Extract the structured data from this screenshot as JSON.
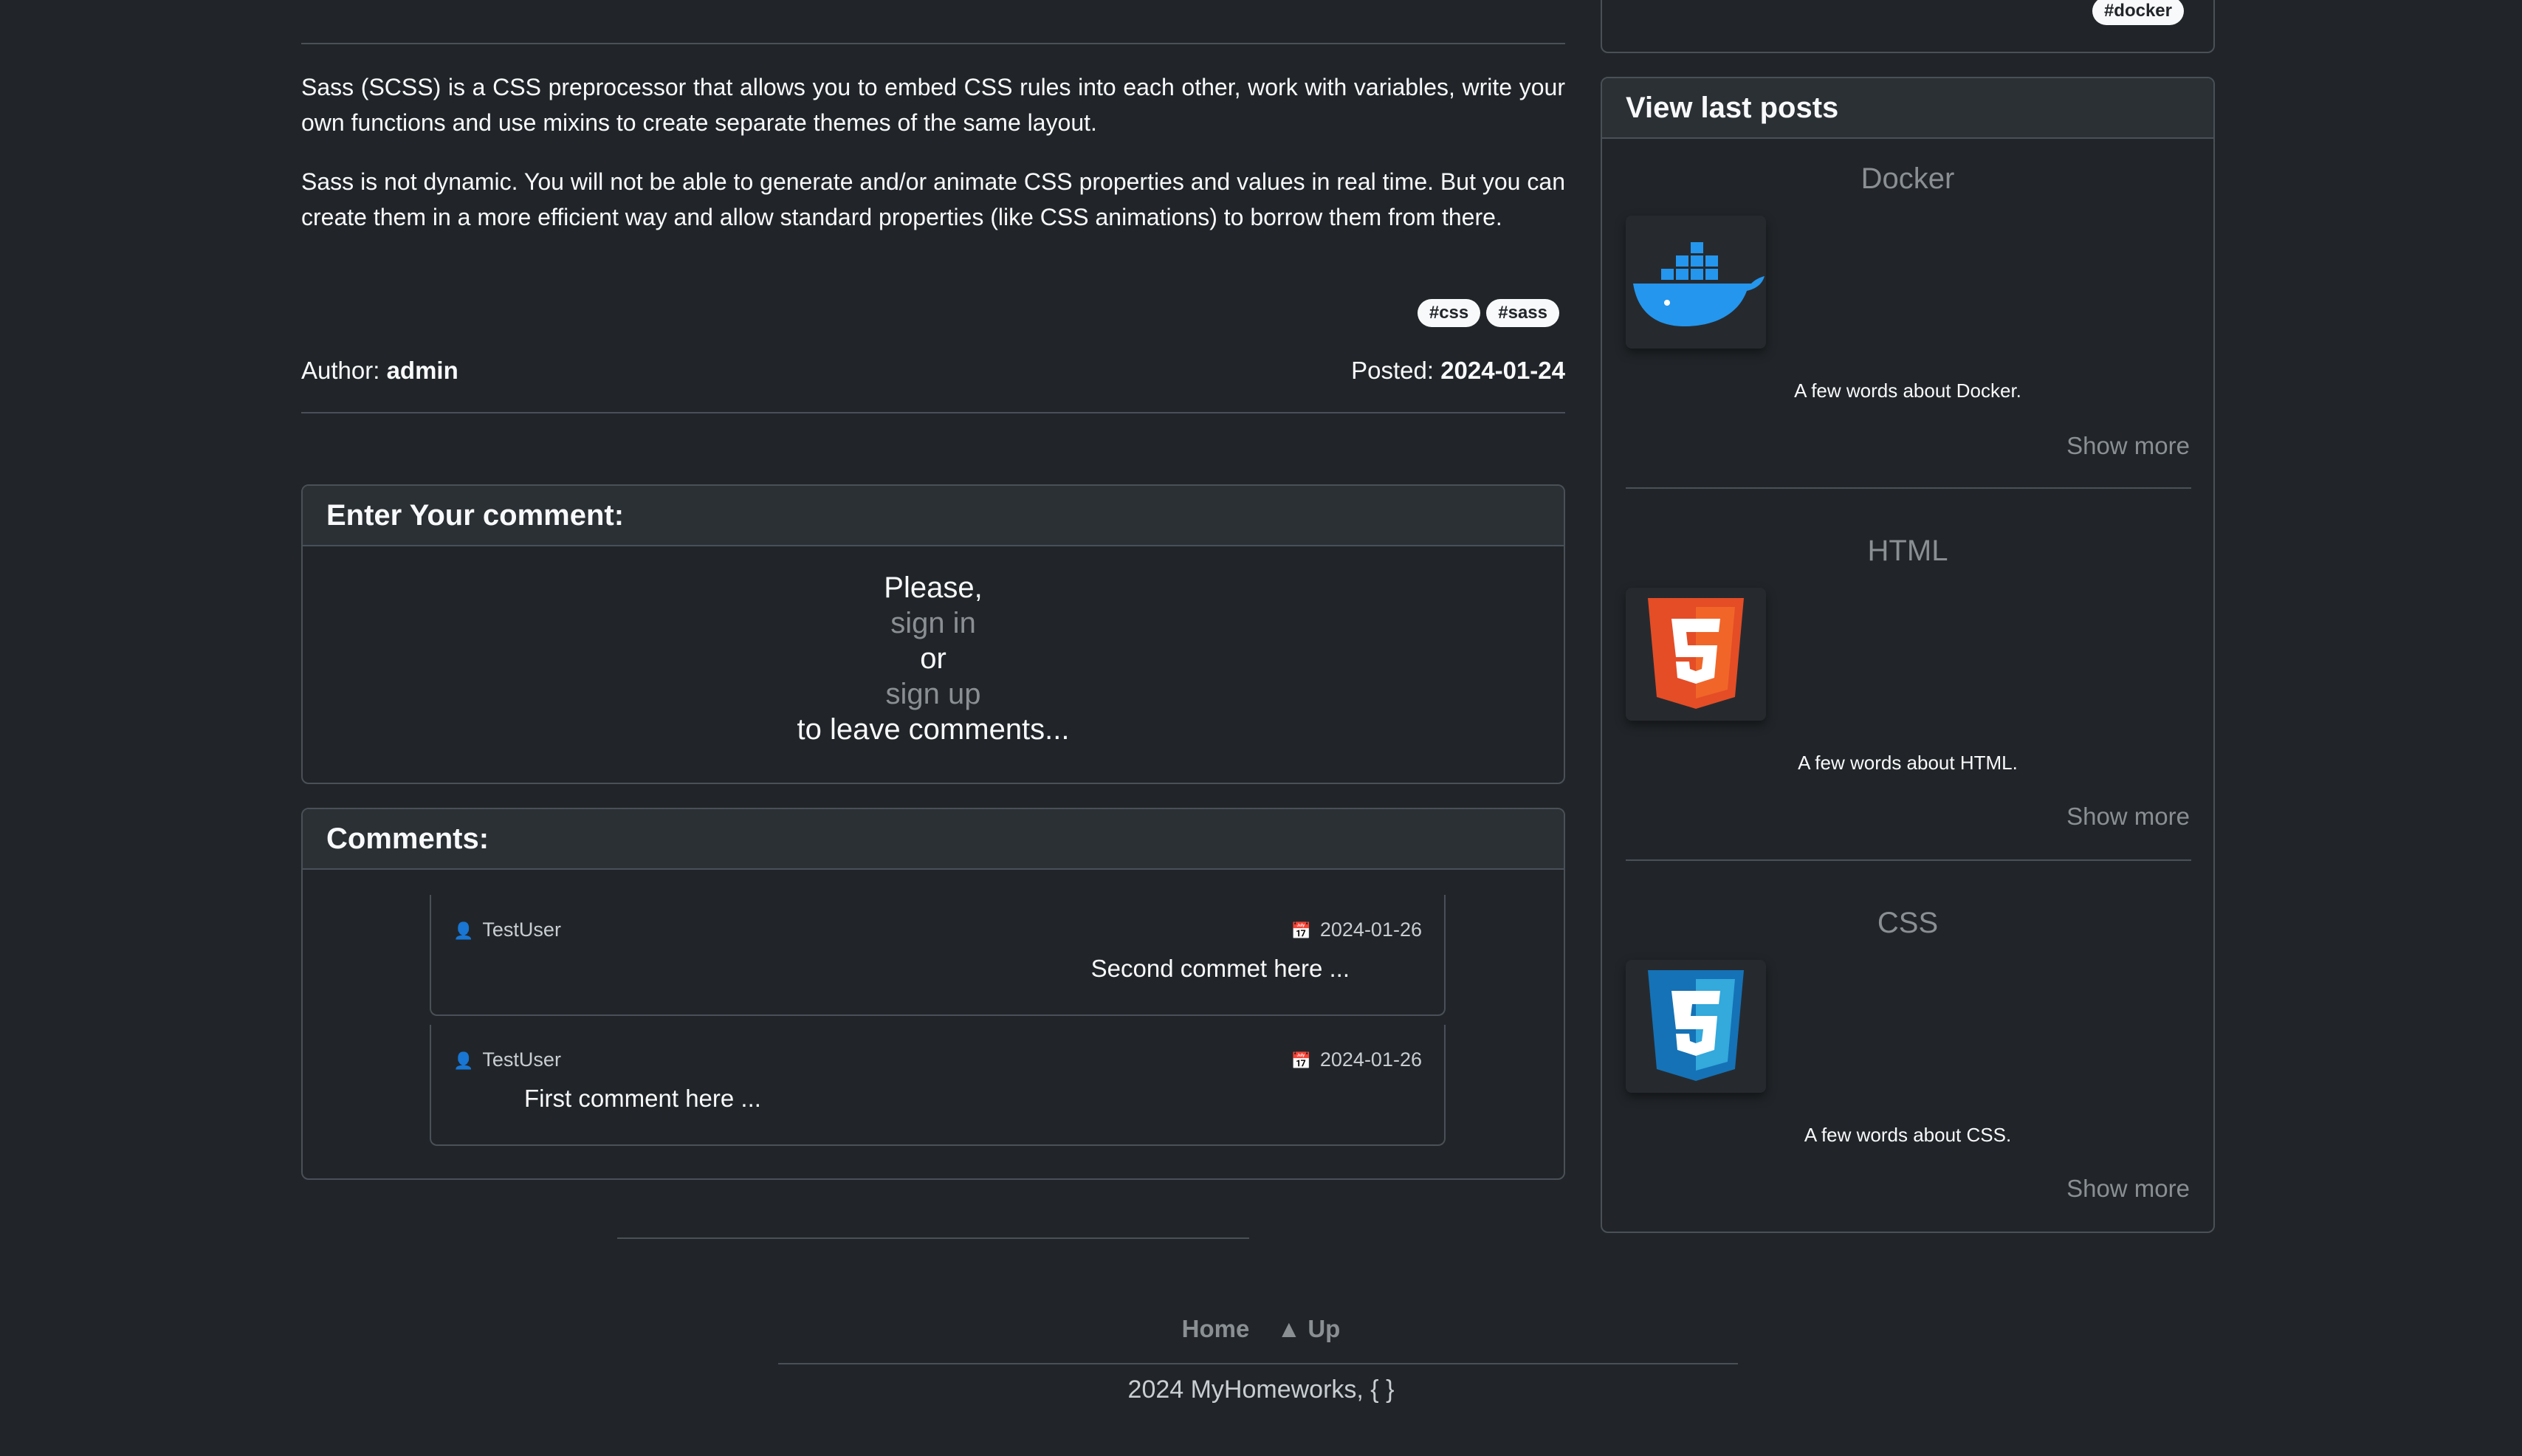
{
  "article": {
    "paragraphs": [
      "Sass (SCSS) is a CSS preprocessor that allows you to embed CSS rules into each other, work with variables, write your own functions and use mixins to create separate themes of the same layout.",
      "Sass is not dynamic. You will not be able to generate and/or animate CSS properties and values in real time. But you can create them in a more efficient way and allow standard properties (like CSS animations) to borrow them from there."
    ],
    "tags": [
      "#css",
      "#sass"
    ],
    "author_label": "Author:",
    "author": "admin",
    "posted_label": "Posted:",
    "posted_date": "2024-01-24"
  },
  "comment_form": {
    "header": "Enter Your comment:",
    "line1": "Please,",
    "sign_in": "sign in",
    "or": "or",
    "sign_up": "sign up",
    "line5": "to leave comments..."
  },
  "comments": {
    "header": "Comments:",
    "items": [
      {
        "user": "TestUser",
        "date": "2024-01-26",
        "text": "Second commet here ..."
      },
      {
        "user": "TestUser",
        "date": "2024-01-26",
        "text": "First comment here ..."
      }
    ]
  },
  "sidebar": {
    "top_tag": "#docker",
    "header": "View last posts",
    "posts": [
      {
        "title": "Docker",
        "desc": "A few words about Docker.",
        "more": "Show more",
        "icon": "docker-logo"
      },
      {
        "title": "HTML",
        "desc": "A few words about HTML.",
        "more": "Show more",
        "icon": "html5-logo"
      },
      {
        "title": "CSS",
        "desc": "A few words about CSS.",
        "more": "Show more",
        "icon": "css3-logo"
      }
    ]
  },
  "footer": {
    "home": "Home",
    "up": "▲ Up",
    "copyright": "2024 MyHomeworks, { }"
  },
  "colors": {
    "background": "#212529",
    "card_header": "#2b3035",
    "border": "#495057",
    "muted_link": "#8a8f94",
    "docker_blue": "#2496ed",
    "html_orange": "#e44d26",
    "css_blue": "#1572b6"
  }
}
